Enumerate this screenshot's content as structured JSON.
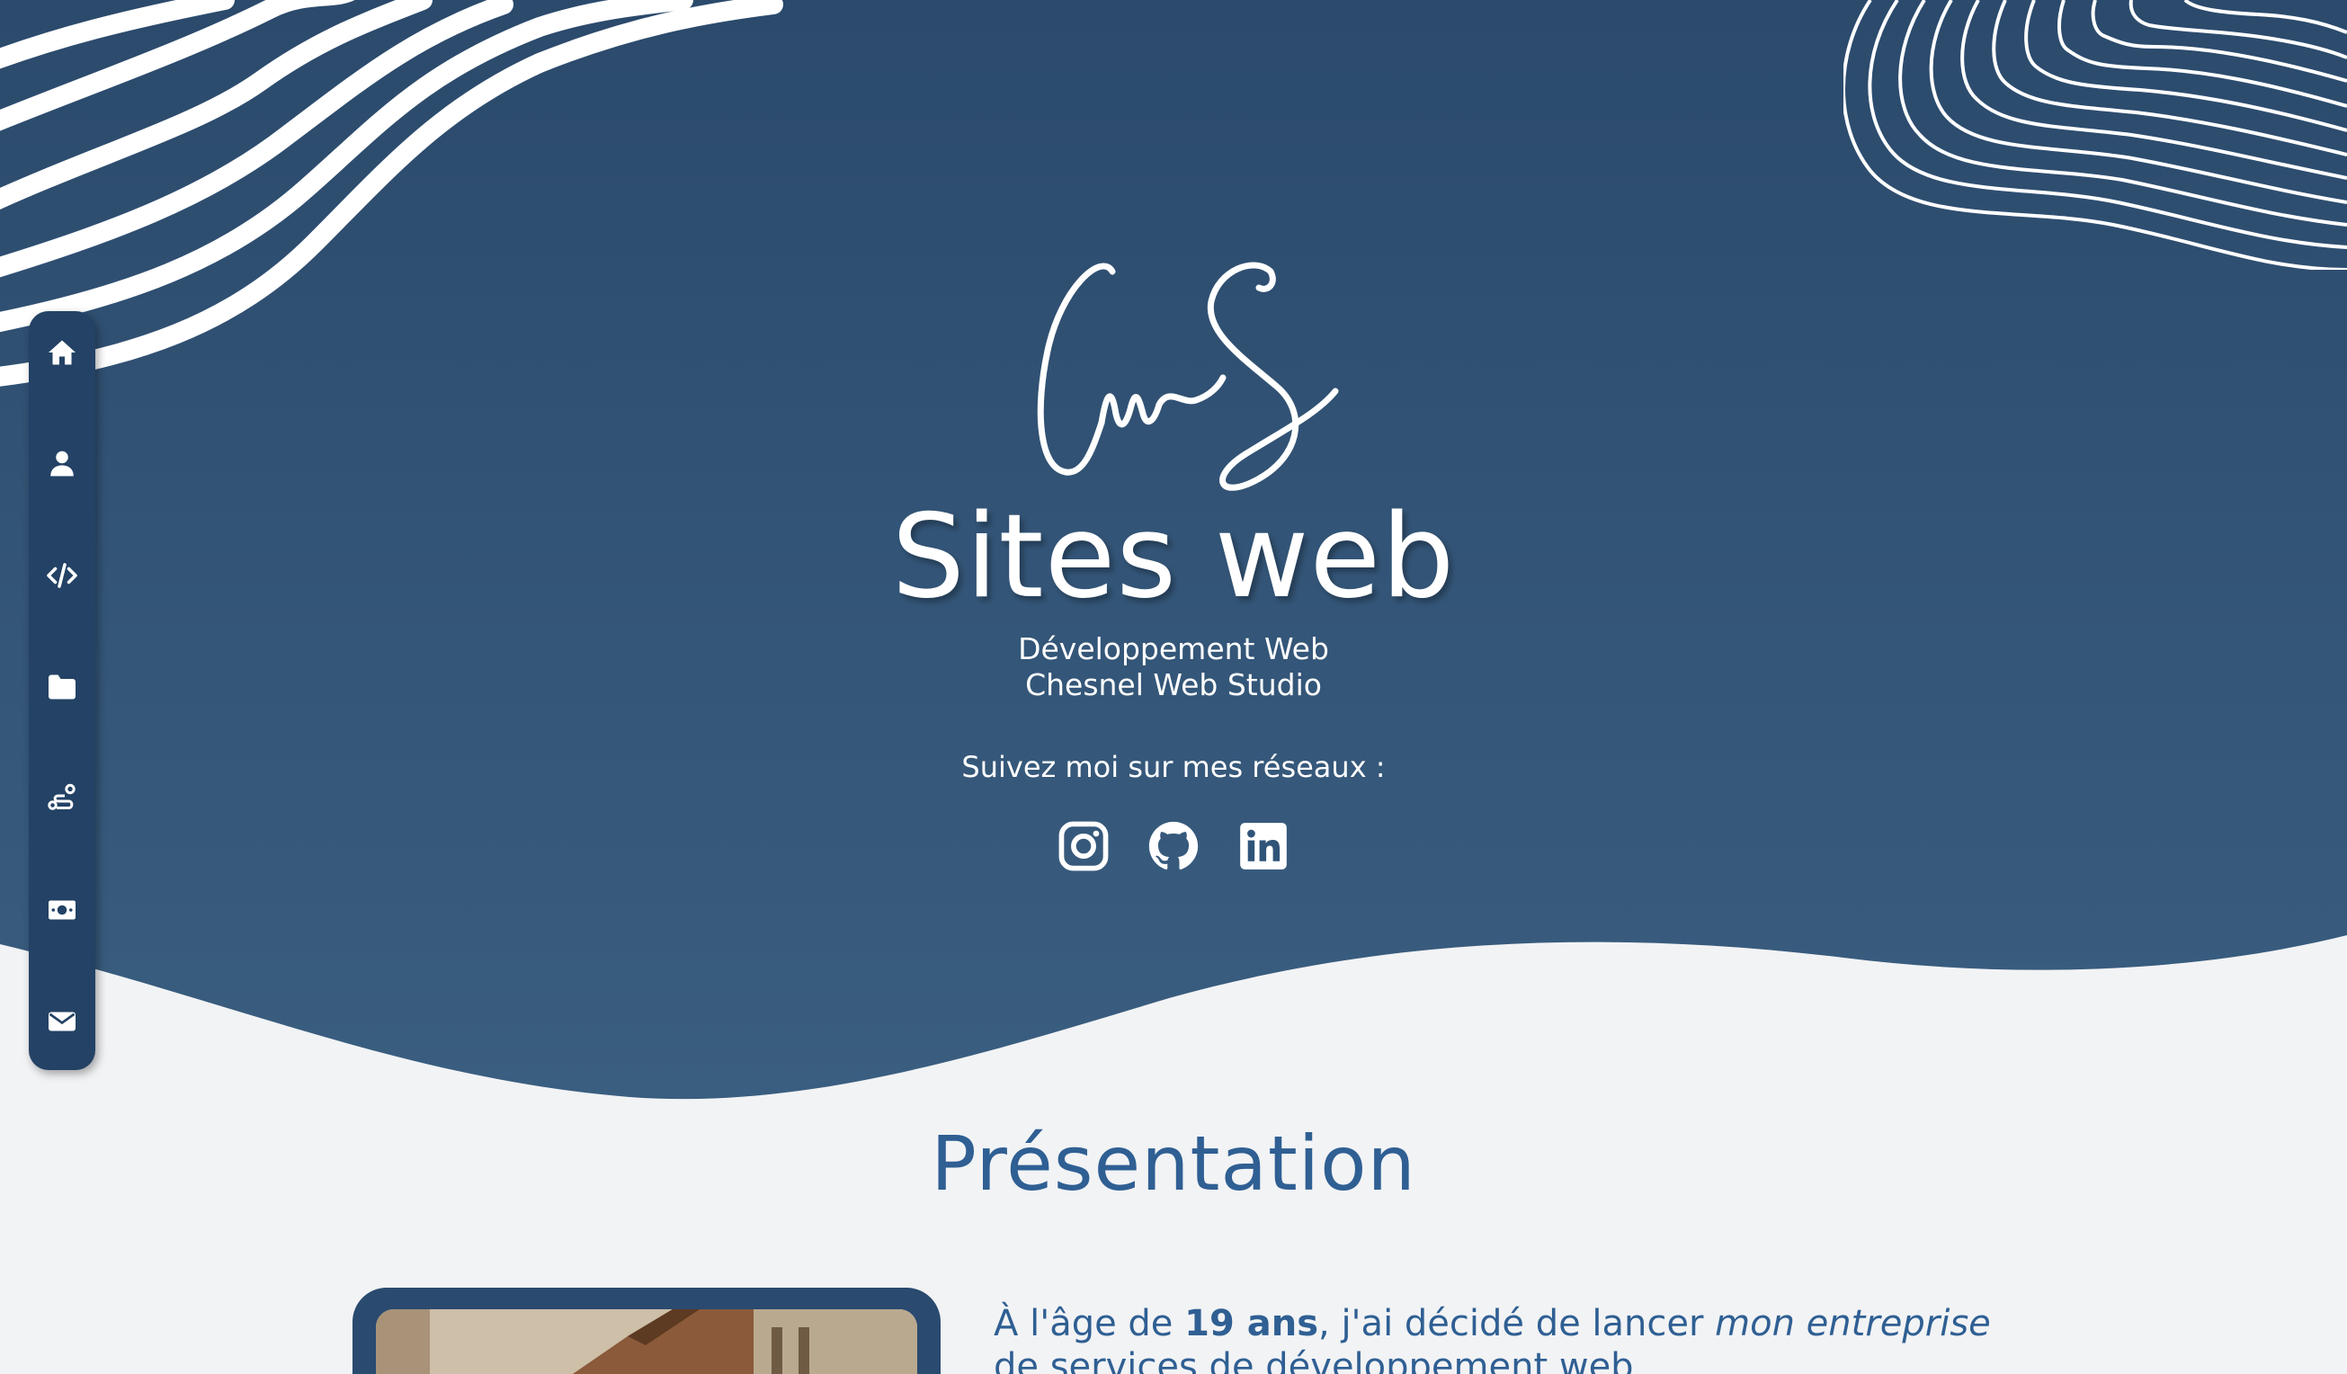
{
  "hero": {
    "signature_logo": "CwS",
    "title": "Sites web",
    "subtitle_line1": "Développement Web",
    "subtitle_line2": "Chesnel Web Studio",
    "follow_text": "Suivez moi sur mes réseaux :",
    "socials": [
      {
        "icon": "instagram-icon",
        "label": "Instagram"
      },
      {
        "icon": "github-icon",
        "label": "GitHub"
      },
      {
        "icon": "linkedin-icon",
        "label": "LinkedIn"
      }
    ]
  },
  "sidebar": {
    "items": [
      {
        "icon": "home-icon"
      },
      {
        "icon": "user-icon"
      },
      {
        "icon": "code-icon"
      },
      {
        "icon": "folder-icon"
      },
      {
        "icon": "route-icon"
      },
      {
        "icon": "money-bill-icon"
      },
      {
        "icon": "envelope-icon"
      }
    ]
  },
  "presentation": {
    "title": "Présentation",
    "intro_part1": "À l'âge de ",
    "intro_bold": "19 ans",
    "intro_part2": ", j'ai décidé de lancer ",
    "intro_italic": "mon entreprise",
    "intro_line2": "de services de développement web"
  },
  "colors": {
    "hero_top": "#2b4a6c",
    "hero_bottom": "#3a5e80",
    "sidebar_bg": "#234265",
    "accent_text": "#2f5f93",
    "page_bg": "#f2f3f5"
  }
}
